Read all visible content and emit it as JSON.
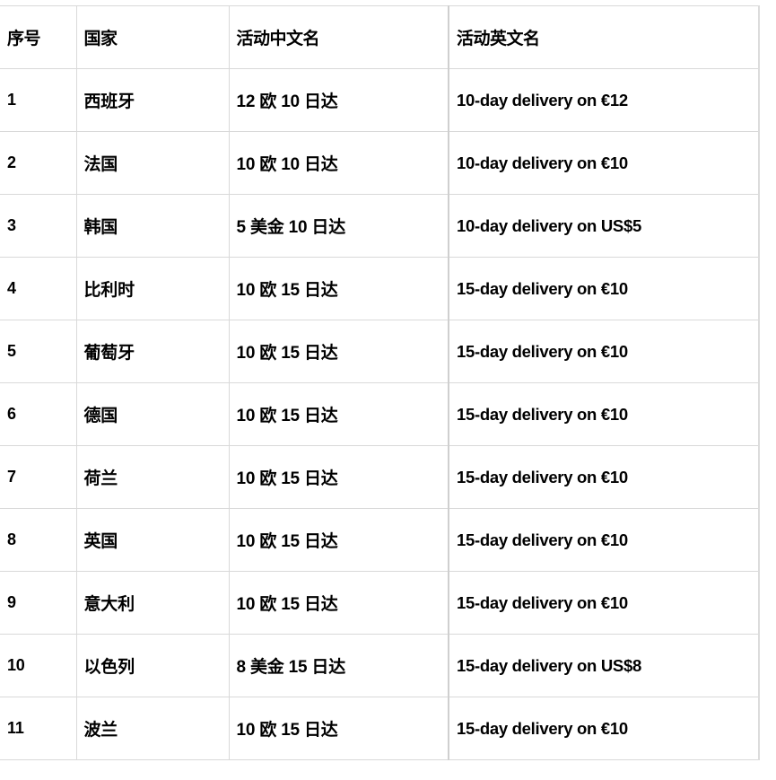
{
  "table": {
    "columns": [
      {
        "key": "index",
        "label": "序号"
      },
      {
        "key": "country",
        "label": "国家"
      },
      {
        "key": "name_zh",
        "label": "活动中文名"
      },
      {
        "key": "name_en",
        "label": "活动英文名"
      }
    ],
    "rows": [
      {
        "index": "1",
        "country": "西班牙",
        "name_zh": "12 欧 10 日达",
        "name_en": "10-day delivery on €12"
      },
      {
        "index": "2",
        "country": "法国",
        "name_zh": "10 欧 10 日达",
        "name_en": "10-day delivery on €10"
      },
      {
        "index": "3",
        "country": "韩国",
        "name_zh": "5 美金 10 日达",
        "name_en": "10-day delivery on US$5"
      },
      {
        "index": "4",
        "country": "比利时",
        "name_zh": "10 欧 15 日达",
        "name_en": "15-day delivery on €10"
      },
      {
        "index": "5",
        "country": "葡萄牙",
        "name_zh": "10 欧 15 日达",
        "name_en": "15-day delivery on €10"
      },
      {
        "index": "6",
        "country": "德国",
        "name_zh": "10 欧 15 日达",
        "name_en": "15-day delivery on €10"
      },
      {
        "index": "7",
        "country": "荷兰",
        "name_zh": "10 欧 15 日达",
        "name_en": "15-day delivery on €10"
      },
      {
        "index": "8",
        "country": "英国",
        "name_zh": "10 欧 15 日达",
        "name_en": "15-day delivery on €10"
      },
      {
        "index": "9",
        "country": "意大利",
        "name_zh": "10 欧 15 日达",
        "name_en": "15-day delivery on €10"
      },
      {
        "index": "10",
        "country": "以色列",
        "name_zh": "8 美金 15 日达",
        "name_en": "15-day delivery on US$8"
      },
      {
        "index": "11",
        "country": "波兰",
        "name_zh": "10 欧 15 日达",
        "name_en": "15-day delivery on €10"
      }
    ]
  },
  "style": {
    "border_color": "#d9d9d9",
    "text_color": "#000000",
    "background": "#ffffff"
  }
}
